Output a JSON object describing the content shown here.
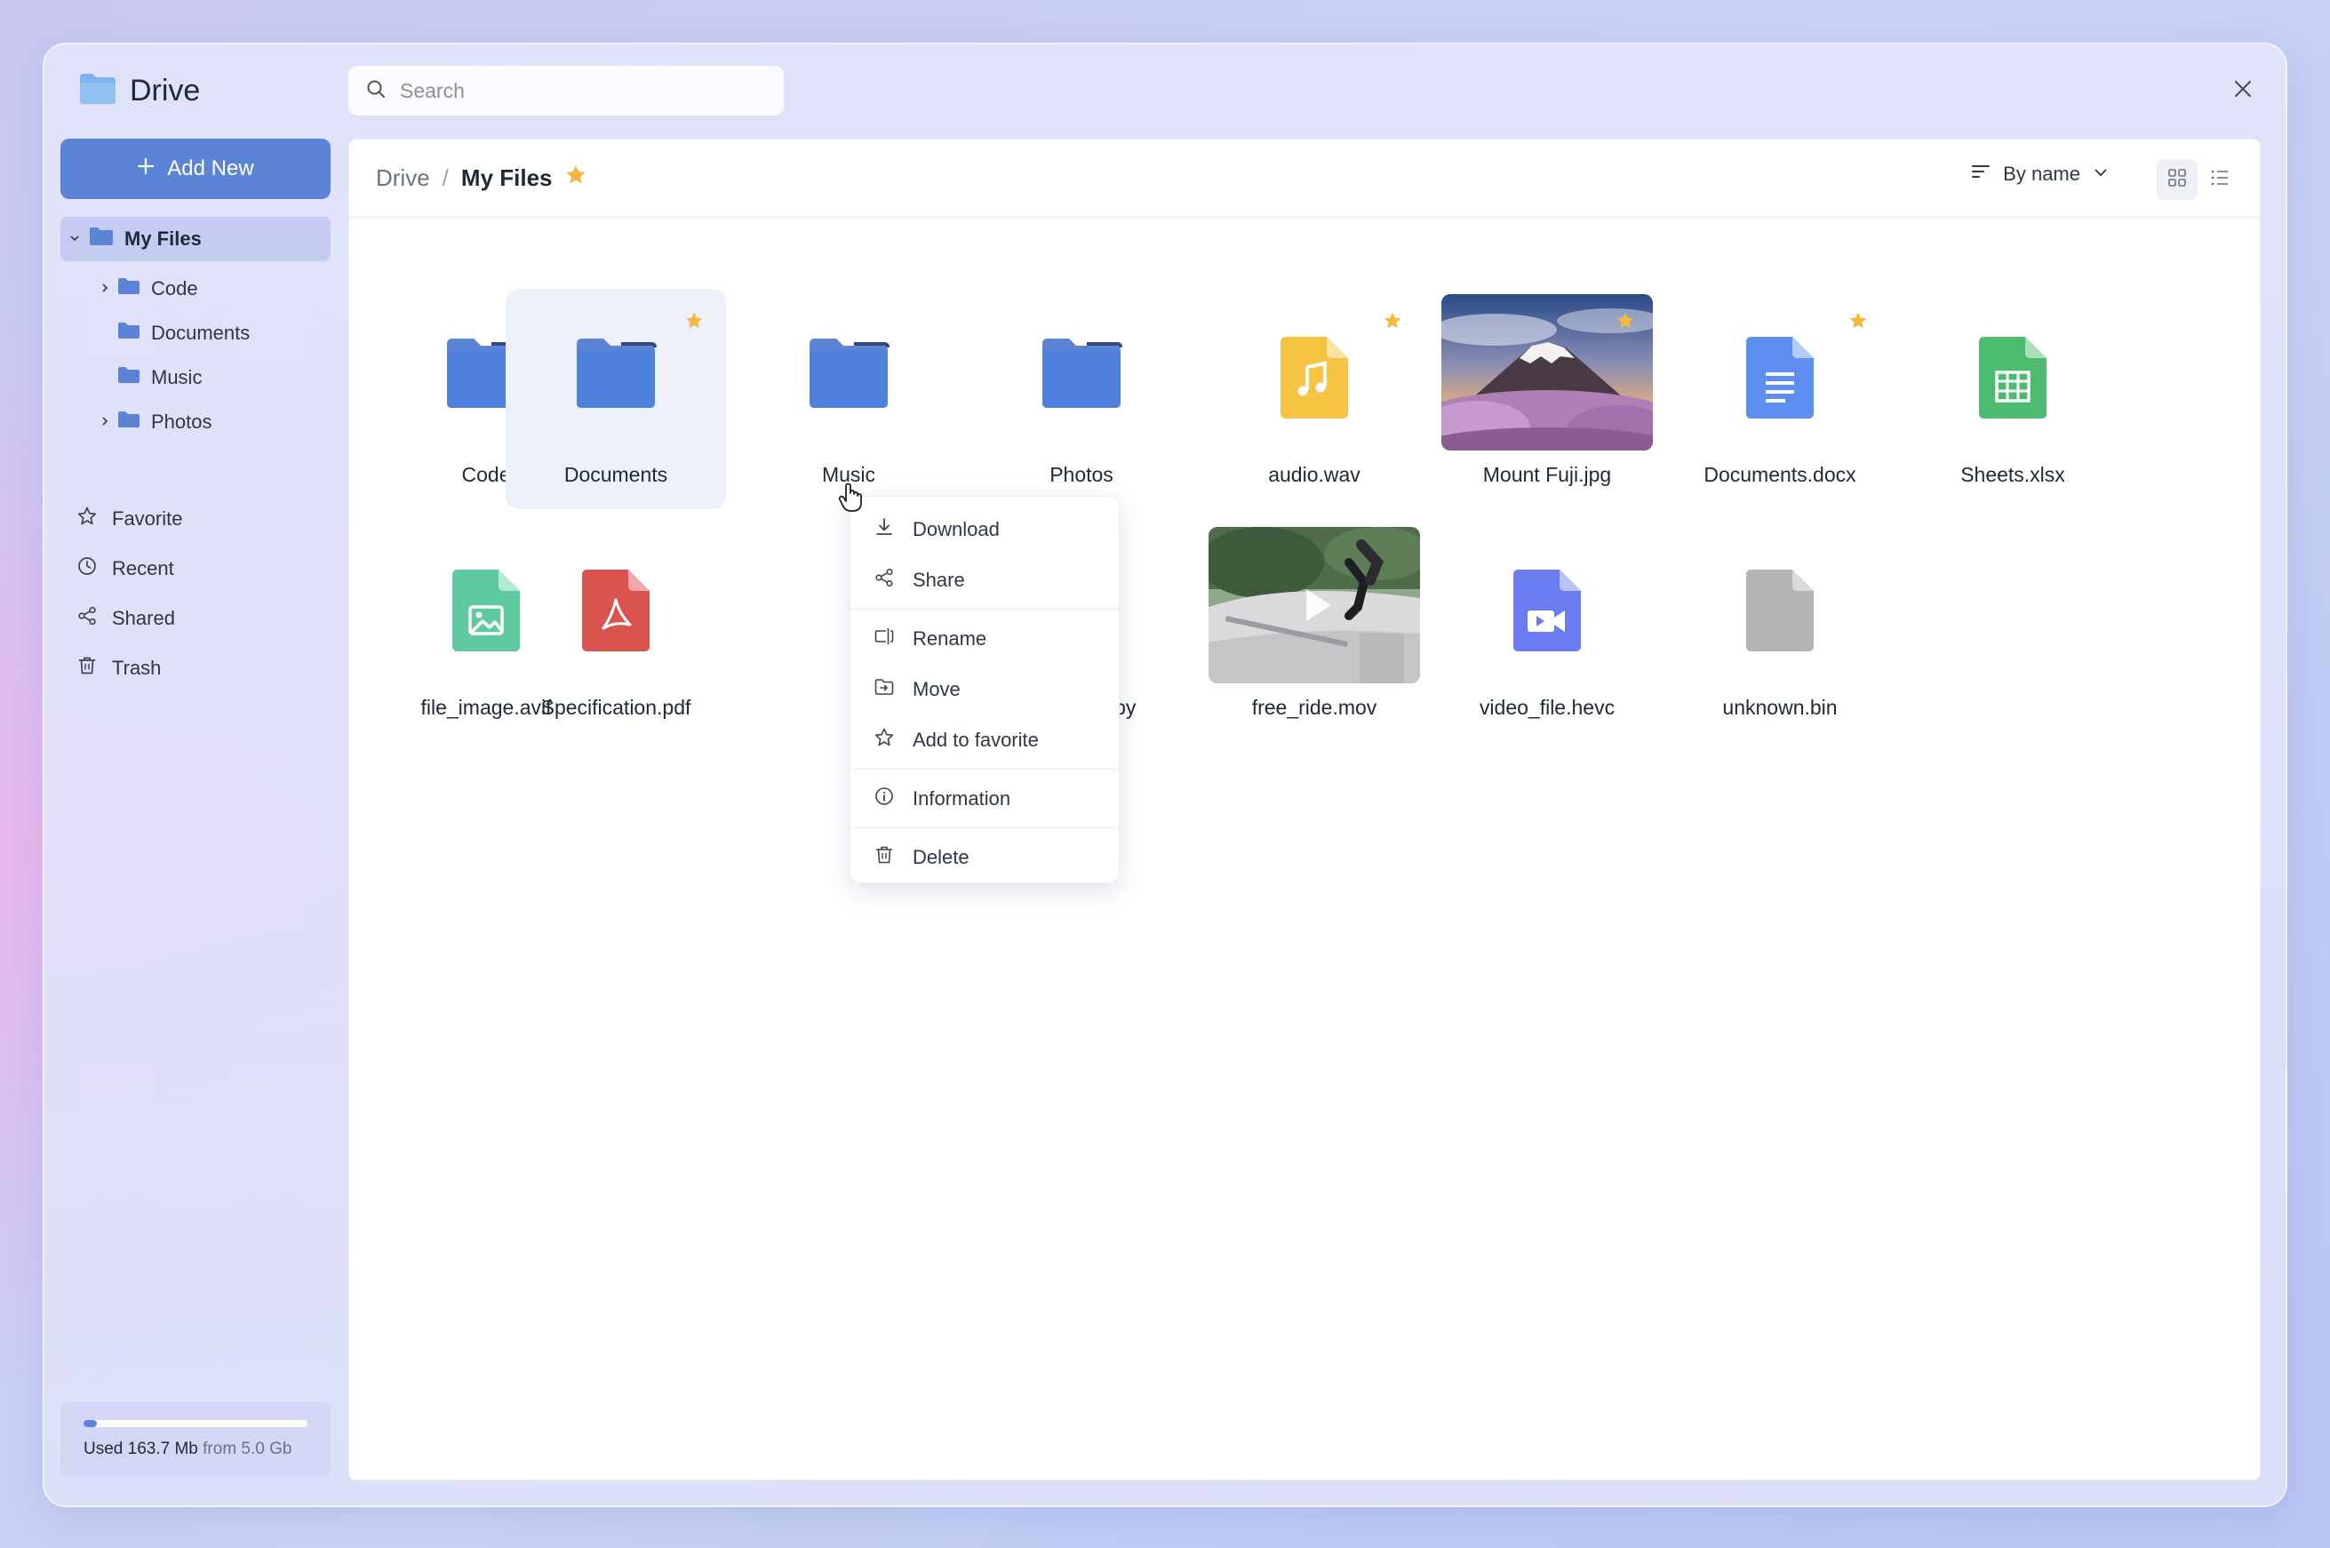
{
  "app": {
    "title": "Drive"
  },
  "search": {
    "placeholder": "Search"
  },
  "sidebar": {
    "add_new_label": "Add New",
    "tree": {
      "root": "My Files",
      "children": [
        {
          "label": "Code",
          "expandable": true
        },
        {
          "label": "Documents",
          "expandable": false
        },
        {
          "label": "Music",
          "expandable": false
        },
        {
          "label": "Photos",
          "expandable": true
        }
      ]
    },
    "nav": [
      {
        "label": "Favorite",
        "icon": "star-icon"
      },
      {
        "label": "Recent",
        "icon": "clock-icon"
      },
      {
        "label": "Shared",
        "icon": "share-icon"
      },
      {
        "label": "Trash",
        "icon": "trash-icon"
      }
    ],
    "storage": {
      "used": "Used 163.7 Mb",
      "total": "from 5.0 Gb",
      "fraction": 0.033
    }
  },
  "header": {
    "breadcrumb_root": "Drive",
    "breadcrumb_separator": "/",
    "breadcrumb_current": "My Files",
    "sort_label": "By name"
  },
  "files": [
    {
      "name": "Code",
      "type": "folder",
      "favorite": false
    },
    {
      "name": "Documents",
      "type": "folder",
      "favorite": true,
      "selected": true
    },
    {
      "name": "Music",
      "type": "folder",
      "favorite": false
    },
    {
      "name": "Photos",
      "type": "folder",
      "favorite": false
    },
    {
      "name": "audio.wav",
      "type": "audio",
      "favorite": true
    },
    {
      "name": "Mount Fuji.jpg",
      "type": "image-thumb",
      "favorite": true
    },
    {
      "name": "Documents.docx",
      "type": "doc",
      "favorite": true
    },
    {
      "name": "Sheets.xlsx",
      "type": "sheet",
      "favorite": false
    },
    {
      "name": "file_image.avif",
      "type": "image",
      "favorite": false
    },
    {
      "name": "Specification.pdf",
      "type": "pdf",
      "favorite": false
    },
    {
      "name": "code_file.py",
      "type": "code",
      "favorite": false
    },
    {
      "name": "free_ride.mov",
      "type": "video-thumb",
      "favorite": false
    },
    {
      "name": "video_file.hevc",
      "type": "video",
      "favorite": false
    },
    {
      "name": "unknown.bin",
      "type": "unknown",
      "favorite": false
    }
  ],
  "context_menu": {
    "items": [
      "Download",
      "Share",
      "Rename",
      "Move",
      "Add to favorite",
      "Information",
      "Delete"
    ]
  },
  "colors": {
    "accent": "#5b84d6",
    "star": "#f4b942",
    "audio": "#f6c343",
    "doc": "#5e8ff0",
    "sheet": "#4dbb6f",
    "image": "#5fcaa0",
    "pdf": "#d9534f",
    "code": "#f08878",
    "video": "#6a7cf0",
    "unknown": "#b3b3b3"
  }
}
